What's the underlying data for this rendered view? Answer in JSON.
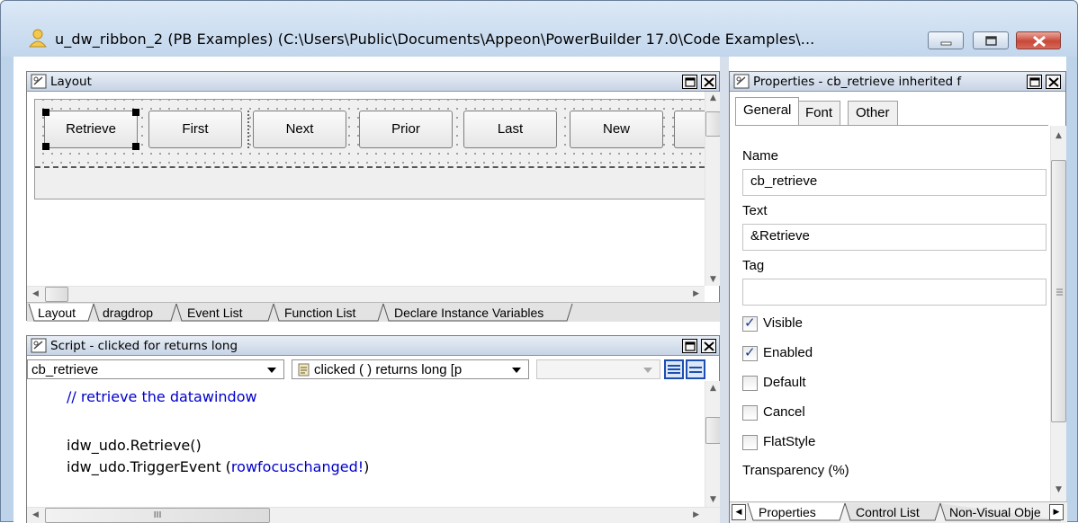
{
  "window": {
    "title": "u_dw_ribbon_2 (PB Examples) (C:\\Users\\Public\\Documents\\Appeon\\PowerBuilder 17.0\\Code Examples\\..."
  },
  "layout_pane": {
    "title": "Layout",
    "buttons": [
      "Retrieve",
      "First",
      "Next",
      "Prior",
      "Last",
      "New"
    ],
    "tabs": [
      "Layout",
      "dragdrop",
      "Event List",
      "Function List",
      "Declare Instance Variables"
    ]
  },
  "script_pane": {
    "title": "Script - clicked for  returns long",
    "object_combo": "cb_retrieve",
    "event_combo": "clicked ( )  returns long [p",
    "code_lines": {
      "line1": "// retrieve the datawindow",
      "line3": "idw_udo.Retrieve()",
      "line4_prefix": "idw_udo.TriggerEvent (",
      "line4_arg": "rowfocuschanged!",
      "line4_suffix": ")"
    },
    "hscroll_thumb_label": "III"
  },
  "properties_pane": {
    "title": "Properties - cb_retrieve  inherited  f",
    "tabs": [
      "General",
      "Font",
      "Other"
    ],
    "fields": {
      "name_label": "Name",
      "name_value": "cb_retrieve",
      "text_label": "Text",
      "text_value": "&Retrieve",
      "tag_label": "Tag",
      "tag_value": ""
    },
    "checkboxes": [
      {
        "label": "Visible",
        "checked": true
      },
      {
        "label": "Enabled",
        "checked": true
      },
      {
        "label": "Default",
        "checked": false
      },
      {
        "label": "Cancel",
        "checked": false
      },
      {
        "label": "FlatStyle",
        "checked": false
      }
    ],
    "transparency_label": "Transparency (%)",
    "bottom_tabs": [
      "Properties",
      "Control List",
      "Non-Visual Obje"
    ]
  },
  "colors": {
    "comment": "#0000cc",
    "enum": "#0000cc",
    "title_bar": "#c2d6ec",
    "close_button": "#c9483a"
  }
}
